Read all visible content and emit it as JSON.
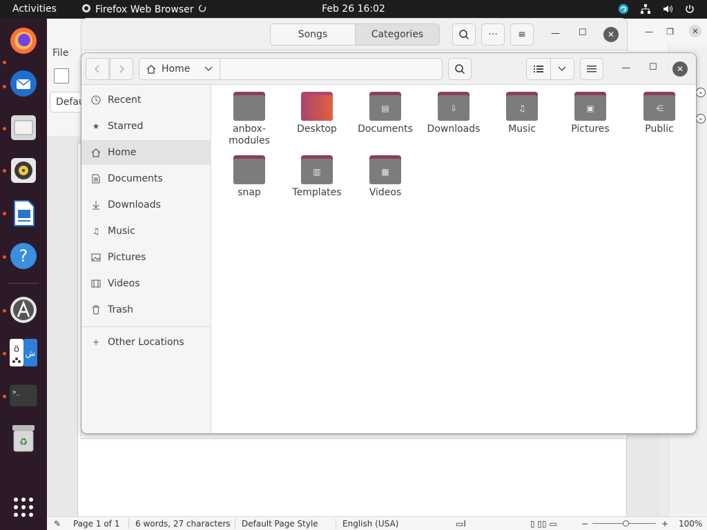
{
  "topbar": {
    "activities": "Activities",
    "app_name": "Firefox Web Browser",
    "clock": "Feb 26  16:02"
  },
  "dock": {
    "items": [
      "firefox",
      "thunderbird",
      "files",
      "rhythmbox",
      "libreoffice-writer",
      "help",
      "software-center",
      "language-support",
      "terminal",
      "trash",
      "show-apps"
    ]
  },
  "writer": {
    "file_menu": "File",
    "style_box": "Defau"
  },
  "statusbar": {
    "page": "Page 1 of 1",
    "words": "6 words, 27 characters",
    "page_style": "Default Page Style",
    "language": "English (USA)",
    "zoom": "100%",
    "zoom_minus": "−",
    "zoom_plus": "+"
  },
  "rhythmbox": {
    "tabs": [
      {
        "label": "Songs",
        "active": false
      },
      {
        "label": "Categories",
        "active": true
      }
    ],
    "more_button": "···",
    "menu_button": "≡"
  },
  "files": {
    "path": "Home",
    "sidebar": [
      {
        "label": "Recent",
        "icon": "clock-icon"
      },
      {
        "label": "Starred",
        "icon": "star-icon"
      },
      {
        "label": "Home",
        "icon": "home-icon",
        "active": true
      },
      {
        "label": "Documents",
        "icon": "document-icon"
      },
      {
        "label": "Downloads",
        "icon": "download-icon"
      },
      {
        "label": "Music",
        "icon": "music-icon"
      },
      {
        "label": "Pictures",
        "icon": "picture-icon"
      },
      {
        "label": "Videos",
        "icon": "video-icon"
      },
      {
        "label": "Trash",
        "icon": "trash-icon"
      },
      {
        "label": "Other Locations",
        "icon": "plus-icon"
      }
    ],
    "folders": [
      {
        "label": "anbox-modules",
        "line1": "anbox-",
        "line2": "modules",
        "emblem": ""
      },
      {
        "label": "Desktop",
        "line1": "Desktop",
        "line2": "",
        "emblem": ""
      },
      {
        "label": "Documents",
        "line1": "Documents",
        "line2": "",
        "emblem": "▤"
      },
      {
        "label": "Downloads",
        "line1": "Downloads",
        "line2": "",
        "emblem": "⇩"
      },
      {
        "label": "Music",
        "line1": "Music",
        "line2": "",
        "emblem": "♫"
      },
      {
        "label": "Pictures",
        "line1": "Pictures",
        "line2": "",
        "emblem": "▣"
      },
      {
        "label": "Public",
        "line1": "Public",
        "line2": "",
        "emblem": "⋲"
      },
      {
        "label": "snap",
        "line1": "snap",
        "line2": "",
        "emblem": ""
      },
      {
        "label": "Templates",
        "line1": "Templates",
        "line2": "",
        "emblem": "▥"
      },
      {
        "label": "Videos",
        "line1": "Videos",
        "line2": "",
        "emblem": "▦"
      }
    ]
  },
  "colors": {
    "dock_bg": "#2d1a28",
    "topbar_bg": "#1d1d1d",
    "accent": "#e95420",
    "folder_tab": "#8a3f5a",
    "folder_body": "#7c7c7c"
  }
}
